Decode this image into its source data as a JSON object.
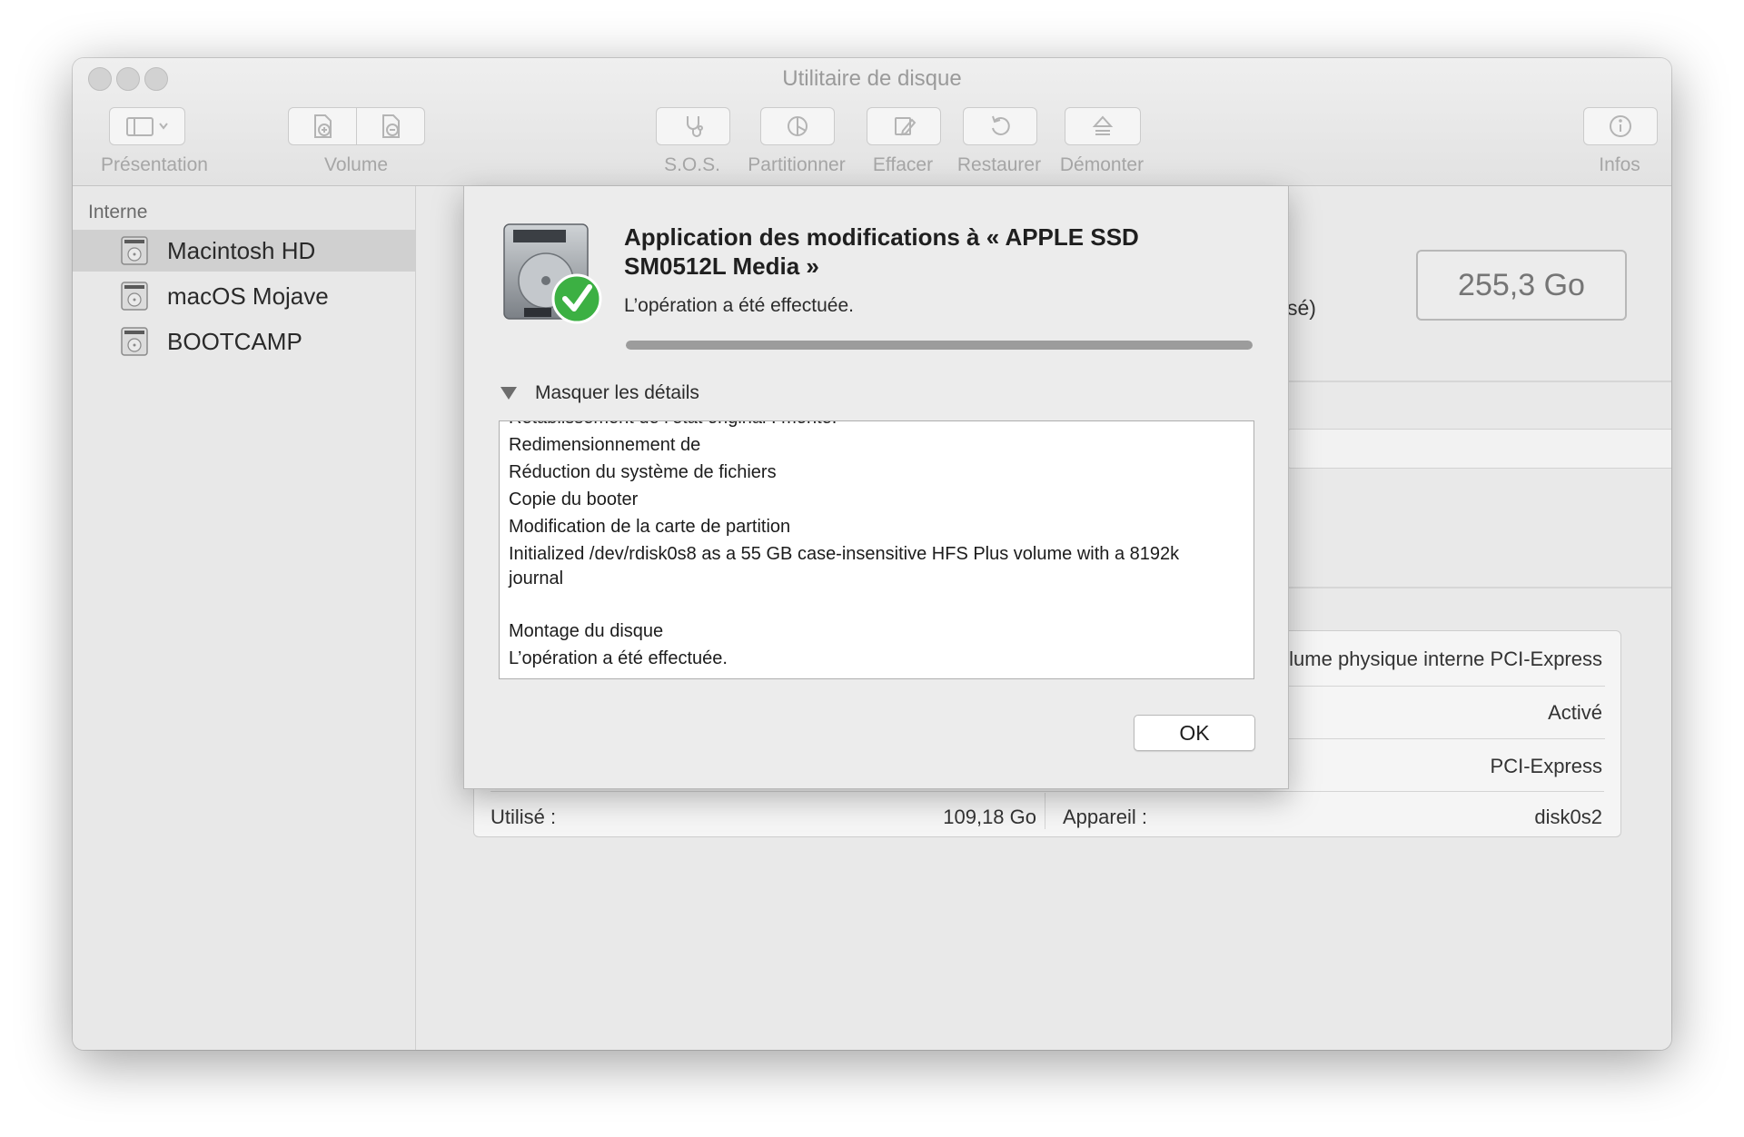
{
  "window": {
    "title": "Utilitaire de disque"
  },
  "toolbar": {
    "presentation": "Présentation",
    "volume": "Volume",
    "sos": "S.O.S.",
    "partition": "Partitionner",
    "erase": "Effacer",
    "restore": "Restaurer",
    "unmount": "Démonter",
    "info": "Infos"
  },
  "sidebar": {
    "section": "Interne",
    "items": [
      {
        "label": "Macintosh HD",
        "selected": true,
        "icon": "internal-disk-icon"
      },
      {
        "label": "macOS Mojave",
        "selected": false,
        "icon": "internal-disk-icon"
      },
      {
        "label": "BOOTCAMP",
        "selected": false,
        "icon": "internal-disk-icon"
      }
    ]
  },
  "main": {
    "capacity": "255,3 Go",
    "partial_text": "sé)",
    "info": {
      "used_label": "Utilisé :",
      "used_value": "109,18 Go",
      "device_label": "Appareil :",
      "device_value": "disk0s2",
      "type_value_partial": "lume physique interne PCI-Express",
      "status_value": "Activé",
      "connection_value": "PCI-Express"
    }
  },
  "sheet": {
    "title": "Application des modifications à « APPLE SSD SM0512L Media »",
    "subtitle": "L’opération a été effectuée.",
    "progress": 1.0,
    "disclosure_label": "Masquer les détails",
    "log": [
      "Rétablissement de l’état original : monté.",
      "Redimensionnement de",
      "Réduction du système de fichiers",
      "Copie du booter",
      "Modification de la carte de partition",
      "Initialized /dev/rdisk0s8 as a 55 GB case-insensitive HFS Plus volume with a 8192k journal",
      "",
      "Montage du disque",
      "L’opération a été effectuée."
    ],
    "ok_label": "OK",
    "icon": "disk-success-icon",
    "success_color": "#3cb043"
  }
}
